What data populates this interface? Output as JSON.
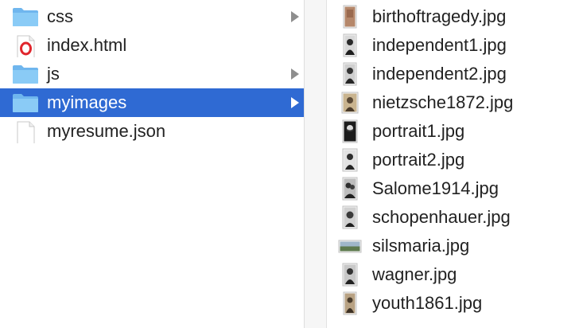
{
  "left_column": {
    "items": [
      {
        "name": "css",
        "kind": "folder",
        "icon": "folder-icon",
        "has_children": true,
        "selected": false
      },
      {
        "name": "index.html",
        "kind": "html-file",
        "icon": "opera-html-file-icon",
        "has_children": false,
        "selected": false
      },
      {
        "name": "js",
        "kind": "folder",
        "icon": "folder-icon",
        "has_children": true,
        "selected": false
      },
      {
        "name": "myimages",
        "kind": "folder",
        "icon": "folder-icon",
        "has_children": true,
        "selected": true
      },
      {
        "name": "myresume.json",
        "kind": "file",
        "icon": "document-icon",
        "has_children": false,
        "selected": false
      }
    ]
  },
  "right_column": {
    "items": [
      {
        "name": "birthoftragedy.jpg",
        "icon": "image-thumbnail-icon"
      },
      {
        "name": "independent1.jpg",
        "icon": "image-thumbnail-icon"
      },
      {
        "name": "independent2.jpg",
        "icon": "image-thumbnail-icon"
      },
      {
        "name": "nietzsche1872.jpg",
        "icon": "image-thumbnail-icon"
      },
      {
        "name": "portrait1.jpg",
        "icon": "image-thumbnail-icon"
      },
      {
        "name": "portrait2.jpg",
        "icon": "image-thumbnail-icon"
      },
      {
        "name": "Salome1914.jpg",
        "icon": "image-thumbnail-icon"
      },
      {
        "name": "schopenhauer.jpg",
        "icon": "image-thumbnail-icon"
      },
      {
        "name": "silsmaria.jpg",
        "icon": "image-thumbnail-icon"
      },
      {
        "name": "wagner.jpg",
        "icon": "image-thumbnail-icon"
      },
      {
        "name": "youth1861.jpg",
        "icon": "image-thumbnail-icon"
      }
    ]
  },
  "colors": {
    "selection": "#2f6ad3",
    "folder": "#7cc0f2",
    "text": "#222222",
    "chevron": "#8e8e8e"
  }
}
